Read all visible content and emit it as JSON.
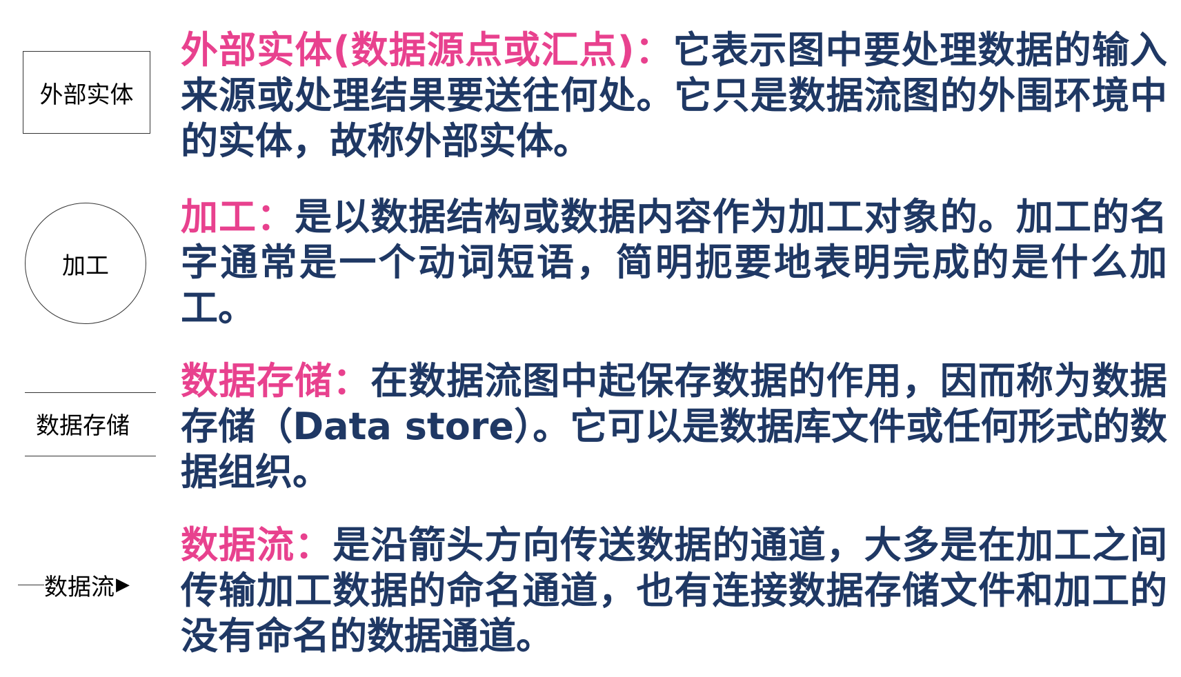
{
  "items": [
    {
      "symbol_label": "外部实体",
      "term": "外部实体(数据源点或汇点)：",
      "description": "它表示图中要处理数据的输入来源或处理结果要送往何处。它只是数据流图的外围环境中的实体，故称外部实体。"
    },
    {
      "symbol_label": "加工",
      "term": "加工：",
      "description": "是以数据结构或数据内容作为加工对象的。加工的名字通常是一个动词短语，简明扼要地表明完成的是什么加工。"
    },
    {
      "symbol_label": "数据存储",
      "term": "数据存储：",
      "description": "在数据流图中起保存数据的作用，因而称为数据存储（Data store）。它可以是数据库文件或任何形式的数据组织。"
    },
    {
      "symbol_label": "数据流",
      "term": "数据流：",
      "description": "是沿箭头方向传送数据的通道，大多是在加工之间传输加工数据的命名通道，也有连接数据存储文件和加工的没有命名的数据通道。"
    }
  ],
  "colors": {
    "term": "#e8418e",
    "description": "#1f3864",
    "symbol": "#000000"
  }
}
